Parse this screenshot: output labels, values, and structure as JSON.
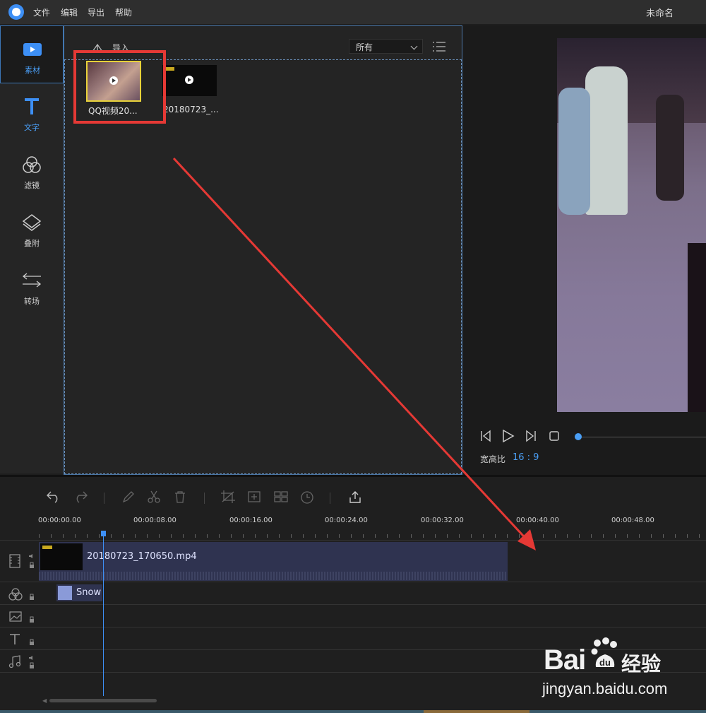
{
  "titlebar": {
    "menus": [
      "文件",
      "编辑",
      "导出",
      "帮助"
    ],
    "doc_title": "未命名"
  },
  "leftnav": {
    "items": [
      {
        "label": "素材",
        "icon": "media-icon"
      },
      {
        "label": "文字",
        "icon": "text-icon"
      },
      {
        "label": "滤镜",
        "icon": "filter-icon"
      },
      {
        "label": "叠附",
        "icon": "overlay-icon"
      },
      {
        "label": "转场",
        "icon": "transition-icon"
      }
    ]
  },
  "media": {
    "import_label": "导入",
    "filter_value": "所有",
    "files": [
      {
        "name": "QQ视频20...",
        "selected": true
      },
      {
        "name": "20180723_...",
        "selected": false
      }
    ]
  },
  "preview": {
    "ratio_label": "宽高比",
    "ratio_value": "16 : 9"
  },
  "timeline": {
    "ticks": [
      "00:00:00.00",
      "00:00:08.00",
      "00:00:16.00",
      "00:00:24.00",
      "00:00:32.00",
      "00:00:40.00",
      "00:00:48.00"
    ],
    "video_clip_name": "20180723_170650.mp4",
    "effect_clip_name": "Snow"
  },
  "watermark": {
    "brand": "Bai",
    "brand_cn": "经验",
    "url": "jingyan.baidu.com"
  },
  "colors": {
    "accent": "#3d8ff5",
    "annotation_red": "#e53935",
    "selected_border": "#e8d23a"
  }
}
